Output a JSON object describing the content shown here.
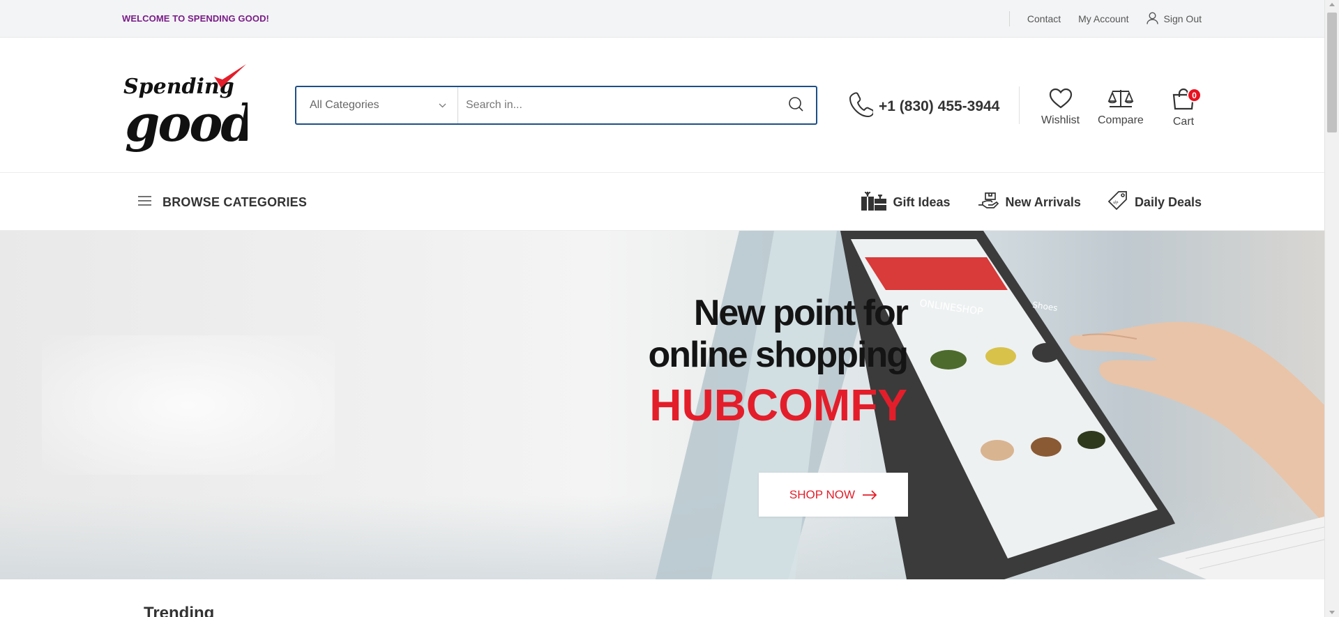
{
  "topbar": {
    "welcome": "WELCOME TO SPENDING GOOD!",
    "links": [
      "Contact",
      "My Account",
      "Sign Out"
    ]
  },
  "header": {
    "logo_text": [
      "Spending",
      "good"
    ],
    "search": {
      "category": "All Categories",
      "placeholder": "Search in..."
    },
    "phone": "+1 (830) 455-3944",
    "wishlist_label": "Wishlist",
    "compare_label": "Compare",
    "cart_label": "Cart",
    "cart_count": "0"
  },
  "nav": {
    "browse_label": "BROWSE CATEGORIES",
    "items": [
      "Gift Ideas",
      "New Arrivals",
      "Daily Deals"
    ]
  },
  "hero": {
    "line1": "New point for",
    "line2": "online shopping",
    "brand": "HUBCOMFY",
    "cta": "SHOP NOW",
    "screen_title": "ONLINESHOP",
    "screen_tab": "Shoes"
  },
  "section_title": "Trending",
  "colors": {
    "brand_purple": "#7a1c87",
    "accent_red": "#e31e2a",
    "search_border": "#1c4f86"
  }
}
